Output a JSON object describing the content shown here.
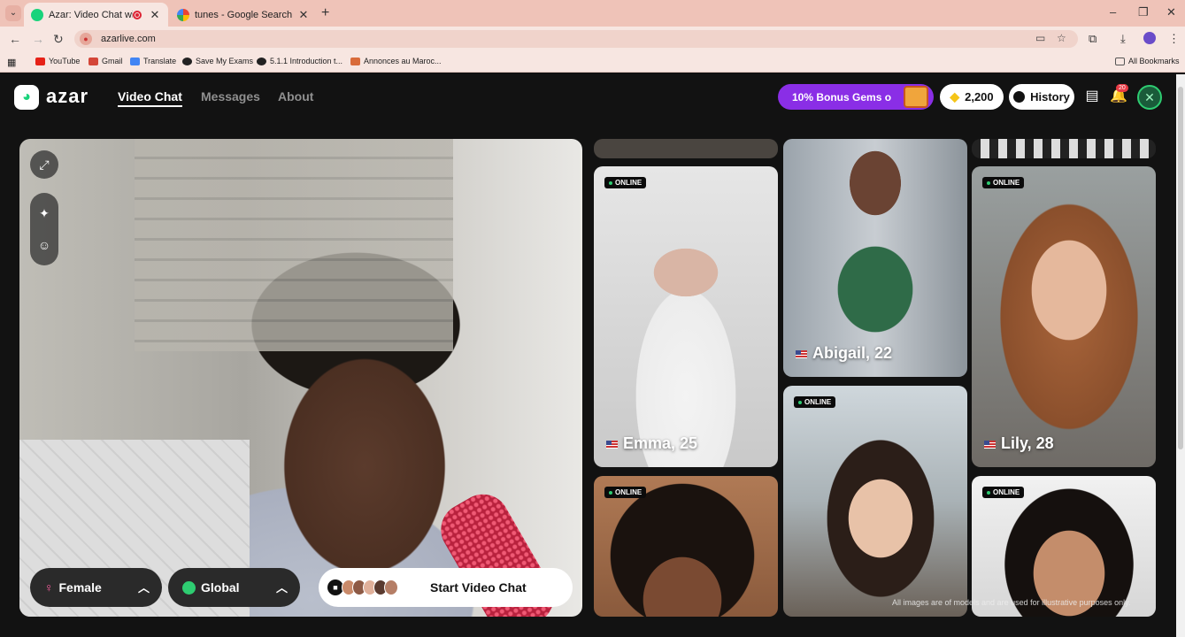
{
  "browser": {
    "tabs": [
      {
        "title": "Azar: Video Chat with New",
        "active": true
      },
      {
        "title": "tunes - Google Search",
        "active": false
      }
    ],
    "new_tab": "+",
    "url": "azarlive.com",
    "bookmarks": [
      "YouTube",
      "Gmail",
      "Translate",
      "Save My Exams",
      "5.1.1 Introduction t...",
      "Annonces au Maroc..."
    ],
    "all_bookmarks": "All Bookmarks",
    "window_controls": [
      "–",
      "❐",
      "✕"
    ]
  },
  "site": {
    "brand": "azar",
    "nav": [
      "Video Chat",
      "Messages",
      "About"
    ],
    "active_nav": "Video Chat",
    "bonus": "10% Bonus Gems o",
    "gems": "2,200",
    "history": "History",
    "notifications_count": "20",
    "colors": {
      "accent_green": "#19d37b",
      "bonus_purple": "#8a2ee6",
      "gem_gold": "#f5c518",
      "online_green": "#2ecc71"
    }
  },
  "video": {
    "tools": [
      "expand-icon",
      "magic-wand-icon",
      "smile-icon"
    ],
    "filters": [
      {
        "label": "Female",
        "icon": "female-icon"
      },
      {
        "label": "Global",
        "icon": "globe-icon"
      }
    ],
    "start_label": "Start Video Chat"
  },
  "cards": [
    {
      "name": "Emma, 25",
      "online": "ONLINE"
    },
    {
      "name": "Abigail, 22",
      "online": ""
    },
    {
      "name": "Lily, 28",
      "online": "ONLINE"
    },
    {
      "name": "",
      "online": "ONLINE"
    },
    {
      "name": "",
      "online": "ONLINE"
    },
    {
      "name": "",
      "online": "ONLINE"
    }
  ],
  "disclaimer": "All images are of models and are used for illustrative purposes only."
}
